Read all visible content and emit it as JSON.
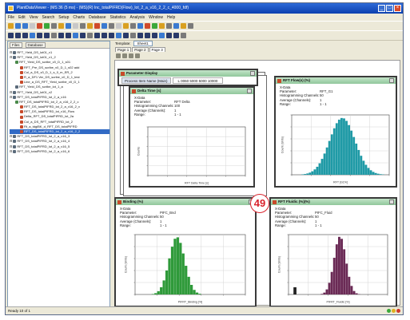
{
  "window": {
    "title": "PlantDataViewer - (MS 36 (5 ms) - (MS)(R) Inc_totalPIFRD(Flow)_lot_2_a_v16_2_2_c_4000_fdf)",
    "controls": [
      "_",
      "□",
      "×"
    ]
  },
  "menu": [
    "File",
    "Edit",
    "View",
    "Search",
    "Setup",
    "Charts",
    "Database",
    "Statistics",
    "Analysis",
    "Window",
    "Help"
  ],
  "left_panel": {
    "tabs": [
      "Files",
      "Database"
    ],
    "tree": [
      {
        "label": "RFT_Yield_DS_lot01_v1",
        "color": "#5a6a7a",
        "indent": 0,
        "selected": false
      },
      {
        "label": "RFT_Yield_DS_lot01_v1_2",
        "color": "#5a6a7a",
        "indent": 0,
        "selected": false
      },
      {
        "label": "RFT_Yield_DS_scribe_v0_D_1_s01",
        "color": "#4a8a4a",
        "indent": 1,
        "selected": false
      },
      {
        "label": "RFT_Pre_DS_scribe_v0_D_1_s02 add",
        "color": "#c84a2a",
        "indent": 2,
        "selected": false
      },
      {
        "label": "Col_a_DS_v0_D_1_s_0_m_ER_2",
        "color": "#c84a2a",
        "indent": 2,
        "selected": false
      },
      {
        "label": "R_a_DF1 Ver_DS_scribe_v0_D_1_test",
        "color": "#c84a2a",
        "indent": 2,
        "selected": false
      },
      {
        "label": "Line_a_DS_RFT_Yield_scribe_v0_D_1",
        "color": "#c84a2a",
        "indent": 2,
        "selected": false
      },
      {
        "label": "RFT_Yield_DS_scribe_lot_1_a",
        "color": "#5a6a7a",
        "indent": 1,
        "selected": false
      },
      {
        "label": "RFT_Yield_DS_lot01_v2",
        "color": "#5a6a7a",
        "indent": 0,
        "selected": false
      },
      {
        "label": "RFT_DS_totalPIFRD_lot_2_a_v16",
        "color": "#5a6a7a",
        "indent": 0,
        "selected": false
      },
      {
        "label": "RFT_DS_totalPIFRD_lot_2_a_v16_2_2_c",
        "color": "#4a8a4a",
        "indent": 1,
        "selected": false
      },
      {
        "label": "RFT_DS_totalPIFRD_lot_2_a_v16_2_v",
        "color": "#c84a2a",
        "indent": 2,
        "selected": false
      },
      {
        "label": "RFT_DS_totalPIFRD_lot_v16_Flow",
        "color": "#c84a2a",
        "indent": 2,
        "selected": false
      },
      {
        "label": "Delta_RFT_DS_totalPIFRD_lot_2a",
        "color": "#c84a2a",
        "indent": 2,
        "selected": false
      },
      {
        "label": "Col_a_DS_RFT_totalPIFRD_lot_2",
        "color": "#c84a2a",
        "indent": 2,
        "selected": false
      },
      {
        "label": "Rt_a_tdgiBK_d_RFT_DS_totalPIFRD",
        "color": "#c84a2a",
        "indent": 2,
        "selected": false
      },
      {
        "label": "RFT_DS_totalPIFRD_lot_2_a_v16_2_2",
        "color": "#c84a2a",
        "indent": 2,
        "selected": true
      },
      {
        "label": "RFT_DS_totalPIFRD_lot_2_a_v16_3",
        "color": "#5a6a7a",
        "indent": 0,
        "selected": false
      },
      {
        "label": "RFT_DS_totalPIFRD_lot_2_a_v16_4",
        "color": "#5a6a7a",
        "indent": 0,
        "selected": false
      },
      {
        "label": "RFT_DS_totalPIFRD_lot_2_a_v16_5",
        "color": "#5a6a7a",
        "indent": 0,
        "selected": false
      },
      {
        "label": "RFT_DS_totalPIFRD_lot_2_a_v16_6",
        "color": "#5a6a7a",
        "indent": 0,
        "selected": false
      }
    ]
  },
  "right_header": {
    "label": "Template:",
    "field": "Sheet1",
    "tabs": [
      "Page 1",
      "Page 2",
      "Page 3"
    ]
  },
  "windows": {
    "back_window": {
      "title": "Parameter Display",
      "meta_key": "Process Item Name (Main)",
      "meta_value": "L 0060 5000 5000 10000"
    },
    "delta": {
      "title": "Delta Time [s]",
      "stats": [
        {
          "k": "X-Data",
          "v": ""
        },
        {
          "k": "Parameter:",
          "v": "RFT Delta"
        },
        {
          "k": "Histogramming Channels:",
          "v": "100"
        },
        {
          "k": "Average (Channels):",
          "v": "1"
        },
        {
          "k": "Range:",
          "v": "1 - 1"
        }
      ],
      "xlabel": "RFT Delta Time [s]",
      "ylabel": "Counts"
    },
    "rft_flow": {
      "title": "RFT Flow(s) (%)",
      "stats": [
        {
          "k": "X-Data",
          "v": ""
        },
        {
          "k": "Parameter:",
          "v": "RFT_G1"
        },
        {
          "k": "Histogramming Channels:",
          "v": "50"
        },
        {
          "k": "Average (Channels):",
          "v": "1"
        },
        {
          "k": "Range:",
          "v": "1 - 1"
        }
      ],
      "xlabel": "RFT [G1%]",
      "ylabel": "Count (Units)"
    },
    "binding": {
      "title": "Binding (%)",
      "stats": [
        {
          "k": "X-Data",
          "v": ""
        },
        {
          "k": "Parameter:",
          "v": "PIFC_Bnd"
        },
        {
          "k": "Histogramming Channels:",
          "v": "50"
        },
        {
          "k": "Average (Channels):",
          "v": "1"
        },
        {
          "k": "Range:",
          "v": "1 - 1"
        }
      ],
      "xlabel": "PIFRT_Binding [%]",
      "ylabel": "Count (Units)"
    },
    "fluidic": {
      "title": "RFT Fluidic (%)(%)",
      "stats": [
        {
          "k": "X-Data",
          "v": ""
        },
        {
          "k": "Parameter:",
          "v": "PIFC_Fluid"
        },
        {
          "k": "Histogramming Channels:",
          "v": "50"
        },
        {
          "k": "Average (Channels):",
          "v": "1"
        },
        {
          "k": "Range:",
          "v": "1 - 1"
        }
      ],
      "xlabel": "PIFRT_Fluidic [%]",
      "ylabel": "Count (Units)"
    }
  },
  "annotation": {
    "label": "49",
    "color": "#d9232d"
  },
  "statusbar": {
    "text": "Ready 10 of 1"
  },
  "colors": {
    "teal": "#1f9aa6",
    "green": "#2f9a3a",
    "purple": "#6a2a55",
    "window_title": "#a9d6b2",
    "titlebar": "#0b3fae"
  }
}
